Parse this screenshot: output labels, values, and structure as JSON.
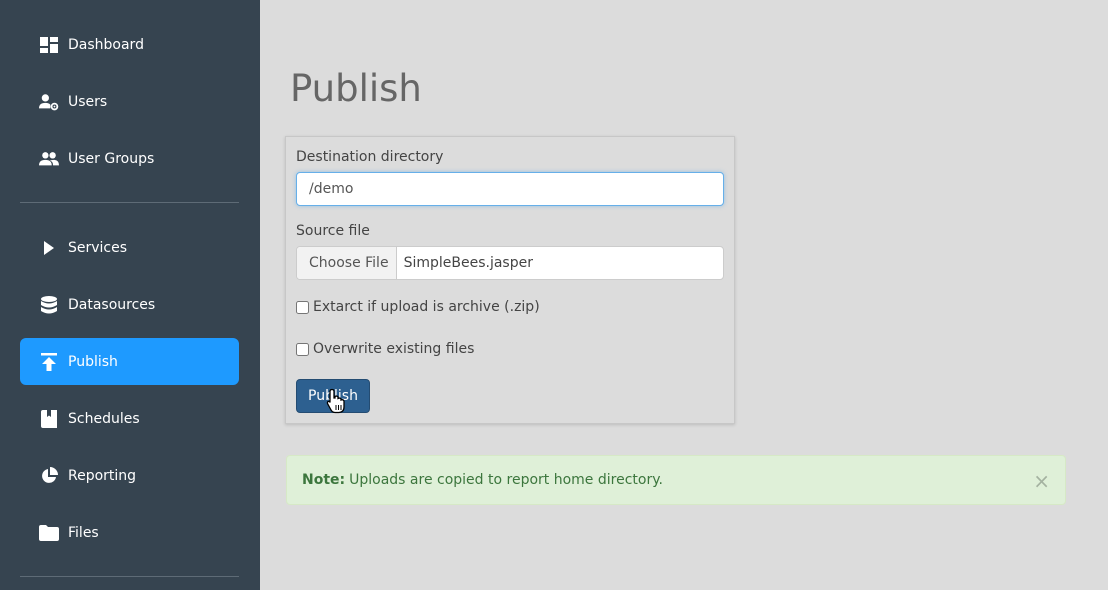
{
  "sidebar": {
    "items": [
      {
        "label": "Dashboard",
        "icon": "dashboard-icon"
      },
      {
        "label": "Users",
        "icon": "user-gear-icon"
      },
      {
        "label": "User Groups",
        "icon": "user-group-icon"
      },
      {
        "label": "Services",
        "icon": "play-icon"
      },
      {
        "label": "Datasources",
        "icon": "database-icon"
      },
      {
        "label": "Publish",
        "icon": "upload-icon",
        "active": true
      },
      {
        "label": "Schedules",
        "icon": "book-icon"
      },
      {
        "label": "Reporting",
        "icon": "pie-chart-icon"
      },
      {
        "label": "Files",
        "icon": "folder-icon"
      }
    ]
  },
  "main": {
    "title": "Publish",
    "form": {
      "destination_label": "Destination directory",
      "destination_value": "/demo",
      "source_label": "Source file",
      "choose_file_label": "Choose File",
      "file_name": "SimpleBees.jasper",
      "extract_label": "Extarct if upload is archive (.zip)",
      "extract_checked": false,
      "overwrite_label": "Overwrite existing files",
      "overwrite_checked": false,
      "publish_button": "Publish"
    },
    "alert": {
      "prefix": "Note:",
      "message": "Uploads are copied to report home directory.",
      "close": "×"
    }
  },
  "colors": {
    "sidebar_bg": "#364450",
    "active_item": "#1e9aff",
    "publish_button": "#2d6090",
    "alert_bg": "#dff0d8"
  }
}
